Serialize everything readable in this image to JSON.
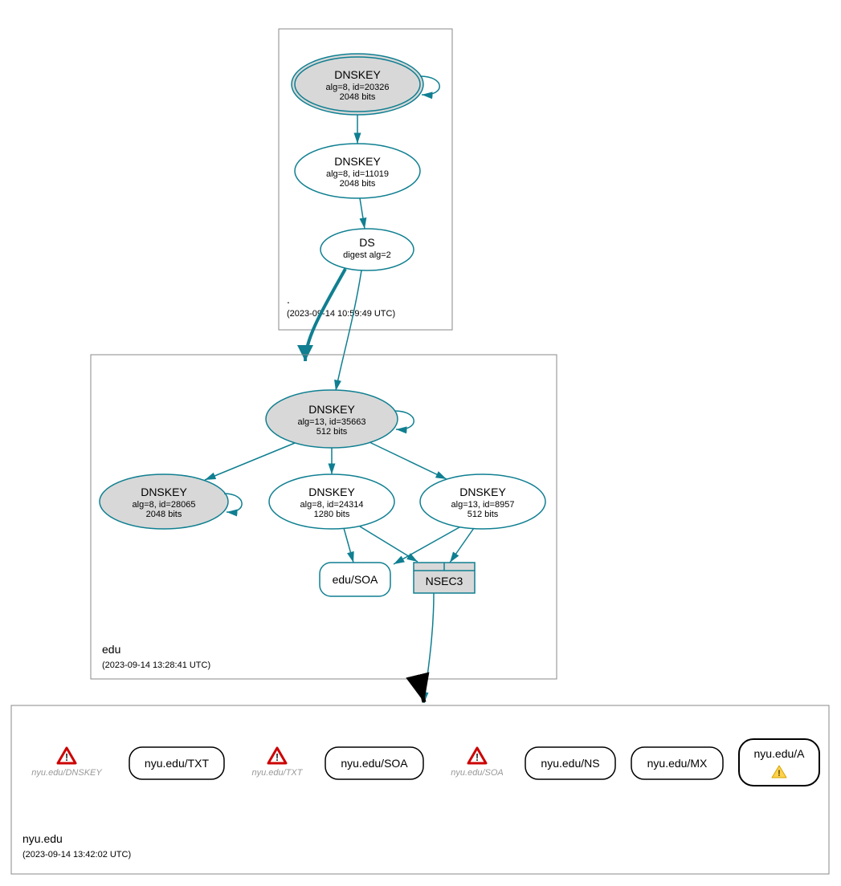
{
  "zones": {
    "root": {
      "label": ".",
      "timestamp": "(2023-09-14 10:59:49 UTC)",
      "nodes": {
        "ksk": {
          "title": "DNSKEY",
          "line1": "alg=8, id=20326",
          "line2": "2048 bits"
        },
        "zsk": {
          "title": "DNSKEY",
          "line1": "alg=8, id=11019",
          "line2": "2048 bits"
        },
        "ds": {
          "title": "DS",
          "line1": "digest alg=2"
        }
      }
    },
    "edu": {
      "label": "edu",
      "timestamp": "(2023-09-14 13:28:41 UTC)",
      "nodes": {
        "ksk": {
          "title": "DNSKEY",
          "line1": "alg=13, id=35663",
          "line2": "512 bits"
        },
        "zskA": {
          "title": "DNSKEY",
          "line1": "alg=8, id=28065",
          "line2": "2048 bits"
        },
        "zskB": {
          "title": "DNSKEY",
          "line1": "alg=8, id=24314",
          "line2": "1280 bits"
        },
        "zskC": {
          "title": "DNSKEY",
          "line1": "alg=13, id=8957",
          "line2": "512 bits"
        },
        "soa": {
          "label": "edu/SOA"
        },
        "nsec": {
          "label": "NSEC3"
        }
      }
    },
    "nyu": {
      "label": "nyu.edu",
      "timestamp": "(2023-09-14 13:42:02 UTC)",
      "nodes": {
        "err_dnskey": {
          "label": "nyu.edu/DNSKEY"
        },
        "txt": {
          "label": "nyu.edu/TXT"
        },
        "err_txt": {
          "label": "nyu.edu/TXT"
        },
        "soa": {
          "label": "nyu.edu/SOA"
        },
        "err_soa": {
          "label": "nyu.edu/SOA"
        },
        "ns": {
          "label": "nyu.edu/NS"
        },
        "mx": {
          "label": "nyu.edu/MX"
        },
        "a": {
          "label": "nyu.edu/A"
        }
      }
    }
  }
}
